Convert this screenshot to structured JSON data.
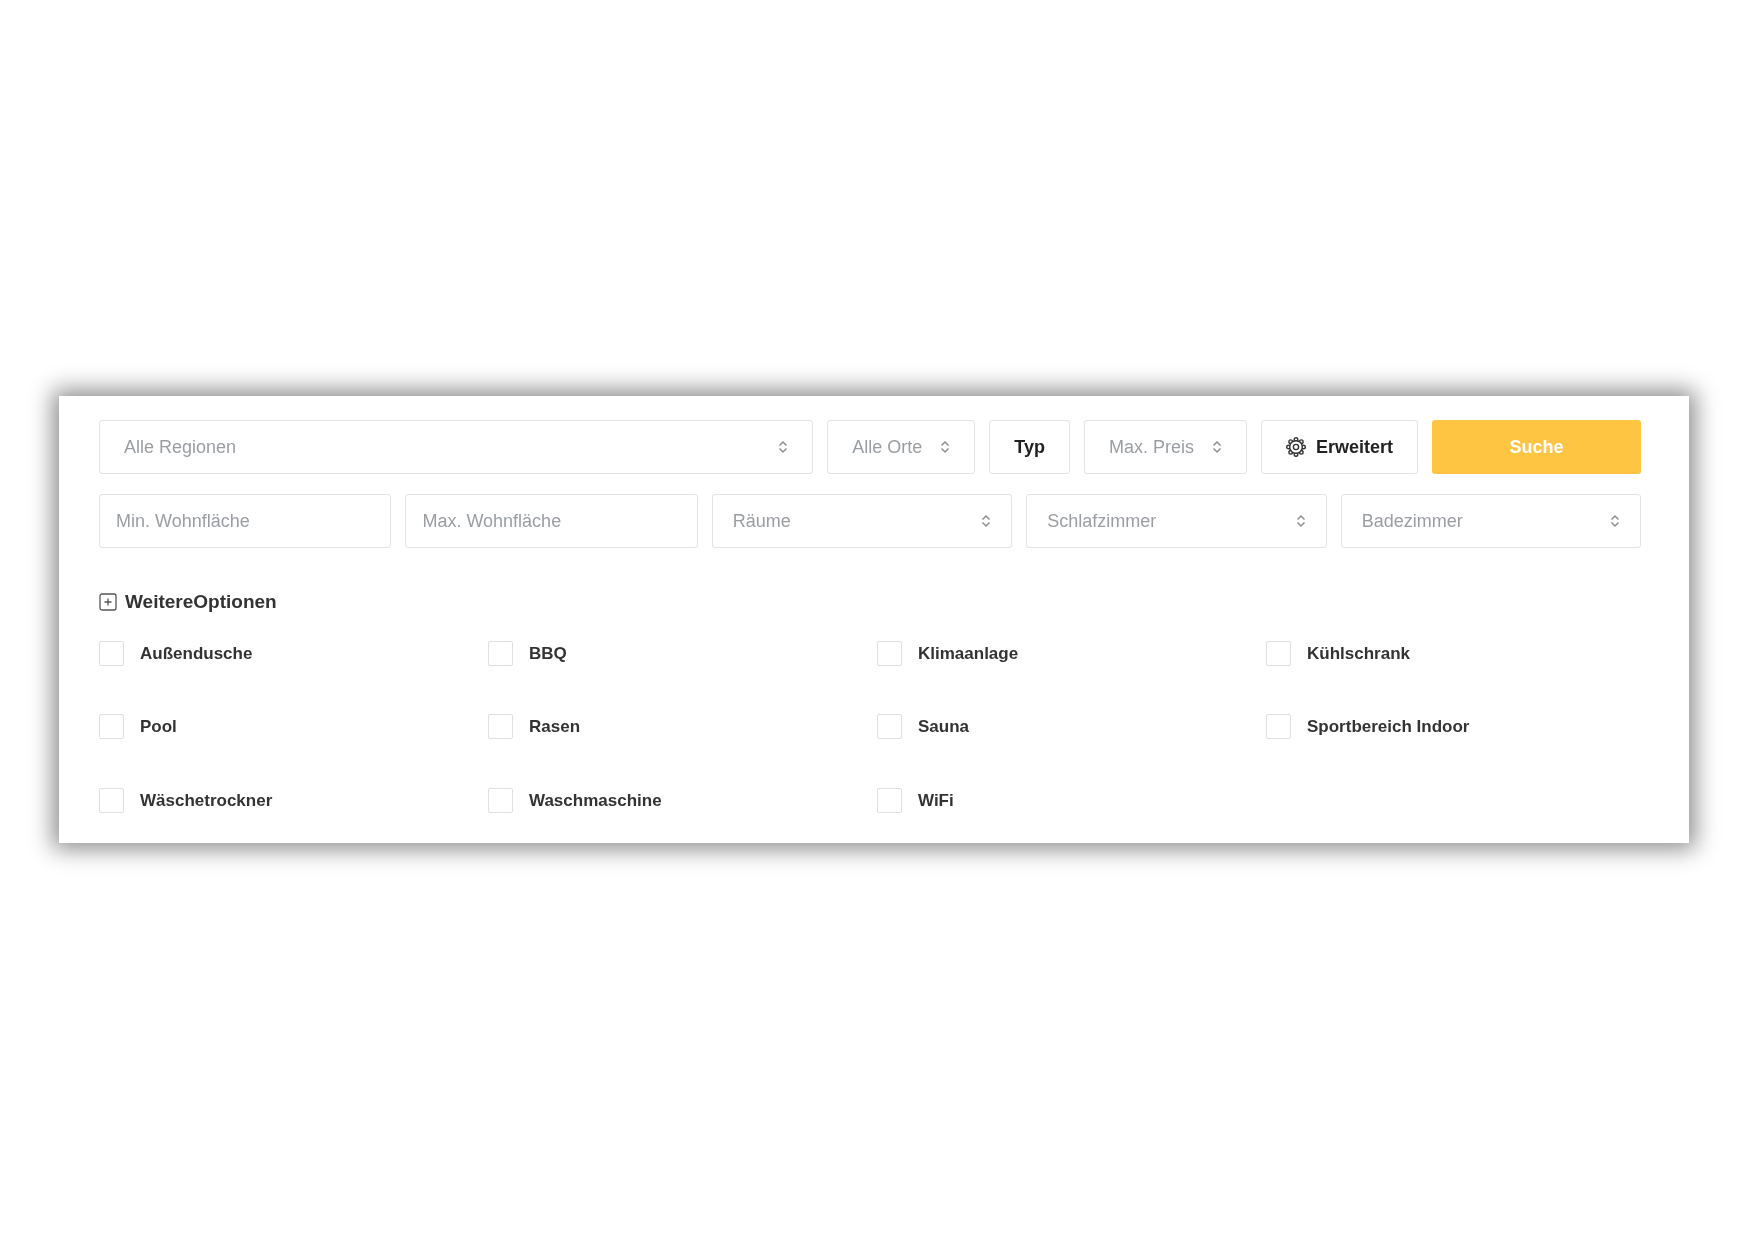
{
  "filters": [
    {
      "kind": "select",
      "label": "Alle Regionen"
    },
    {
      "kind": "select",
      "label": "Alle Orte"
    },
    {
      "kind": "button",
      "label": "Typ"
    },
    {
      "kind": "select",
      "label": "Max. Preis"
    },
    {
      "kind": "settings",
      "label": "Erweitert"
    },
    {
      "kind": "primary",
      "label": "Suche"
    }
  ],
  "ranges": [
    {
      "kind": "input",
      "placeholder": "Min. Wohnfläche"
    },
    {
      "kind": "input",
      "placeholder": "Max. Wohnfläche"
    },
    {
      "kind": "select",
      "label": "Räume"
    },
    {
      "kind": "select",
      "label": "Schlafzimmer"
    },
    {
      "kind": "select",
      "label": "Badezimmer"
    }
  ],
  "more_options": {
    "label": "WeitereOptionen",
    "expanded": true
  },
  "amenities": [
    {
      "label": "Außendusche",
      "checked": false
    },
    {
      "label": "BBQ",
      "checked": false
    },
    {
      "label": "Klimaanlage",
      "checked": false
    },
    {
      "label": "Kühlschrank",
      "checked": false
    },
    {
      "label": "Pool",
      "checked": false
    },
    {
      "label": "Rasen",
      "checked": false
    },
    {
      "label": "Sauna",
      "checked": false
    },
    {
      "label": "Sportbereich Indoor",
      "checked": false
    },
    {
      "label": "Wäschetrockner",
      "checked": false
    },
    {
      "label": "Waschmaschine",
      "checked": false
    },
    {
      "label": "WiFi",
      "checked": false
    }
  ]
}
